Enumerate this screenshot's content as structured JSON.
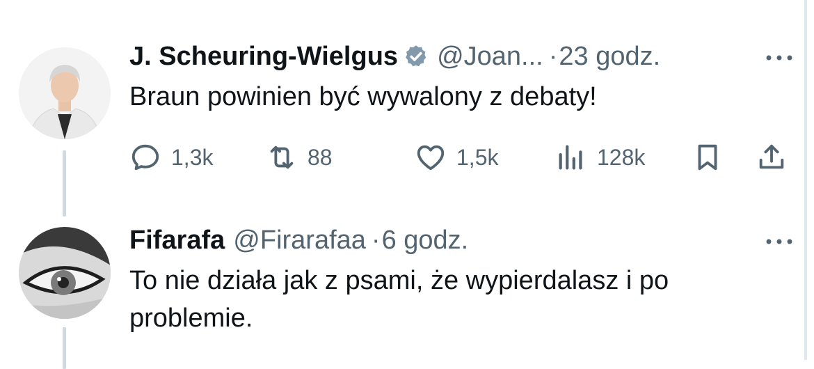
{
  "tweets": [
    {
      "author_name": "J. Scheuring-Wielgus",
      "handle": "@Joan...",
      "separator": "·",
      "time": "23 godz.",
      "text": "Braun powinien być wywalony z debaty!",
      "verified_icon": "verified-badge-icon",
      "actions": {
        "replies": "1,3k",
        "reposts": "88",
        "likes": "1,5k",
        "views": "128k"
      }
    },
    {
      "author_name": "Fifarafa",
      "handle": "@Firarafaa",
      "separator": "·",
      "time": "6 godz.",
      "text": "To nie działa jak z psami, że wypierdalasz i po problemie."
    }
  ],
  "colors": {
    "primary_text": "#0f1419",
    "secondary_text": "#536471",
    "verified_badge": "#829aab",
    "thread_line": "#cfd9de"
  },
  "icons": [
    "more-icon",
    "reply-icon",
    "repost-icon",
    "like-icon",
    "views-icon",
    "bookmark-icon",
    "share-icon"
  ]
}
